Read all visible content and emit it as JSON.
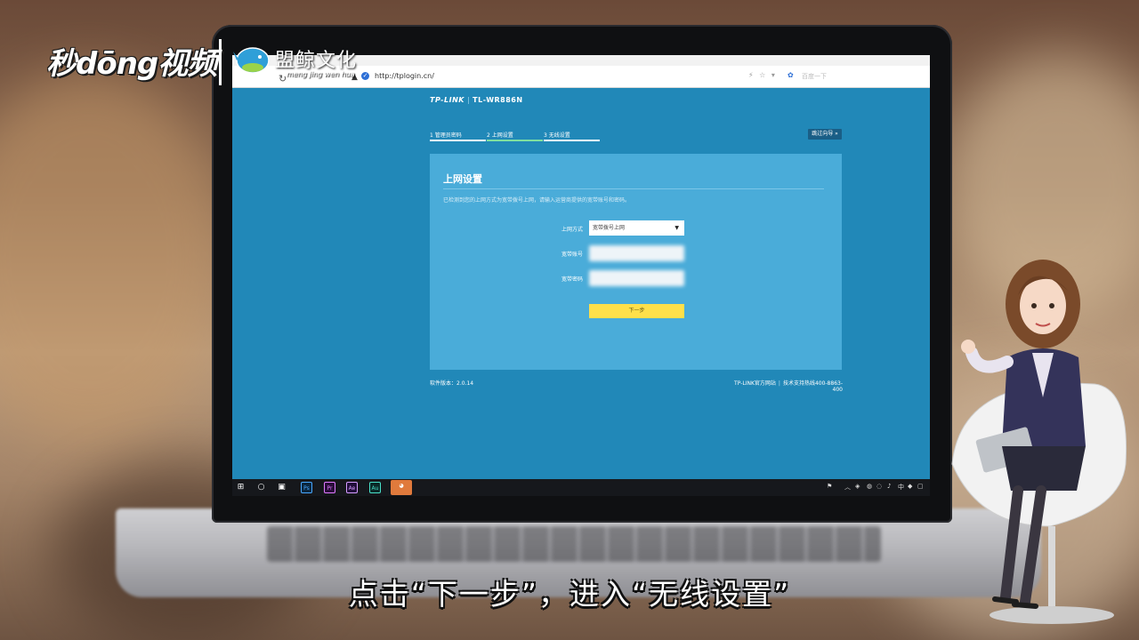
{
  "overlay": {
    "logo_left": "秒dōng视频",
    "logo_right": "盟鲸文化",
    "logo_right_pinyin": "meng jing wen hua",
    "subtitle": "点击“下一步”，进入“无线设置”"
  },
  "browser": {
    "url": "http://tplogin.cn/",
    "search_placeholder": "百度一下"
  },
  "router": {
    "brand": "TP-LINK",
    "model": "TL-WR886N",
    "steps": [
      {
        "label": "1 管理员密码"
      },
      {
        "label": "2 上网设置"
      },
      {
        "label": "3 无线设置"
      }
    ],
    "skip_label": "跳过向导 »",
    "panel_title": "上网设置",
    "panel_desc": "已检测到您的上网方式为宽带拨号上网，请输入运营商提供的宽带账号和密码。",
    "fields": {
      "mode_label": "上网方式",
      "mode_value": "宽带拨号上网",
      "account_label": "宽带账号",
      "password_label": "宽带密码"
    },
    "next_label": "下一步",
    "footer_version": "软件版本：2.0.14",
    "footer_site": "TP-LINK官方网站",
    "footer_support": "技术支持热线400-8863-400"
  },
  "taskbar": {
    "apps": [
      "Ps",
      "Pr",
      "Ae",
      "Au"
    ]
  },
  "colors": {
    "screen_bg": "#2188b8",
    "panel_bg": "#4aacd9",
    "next_button": "#ffe04a"
  }
}
